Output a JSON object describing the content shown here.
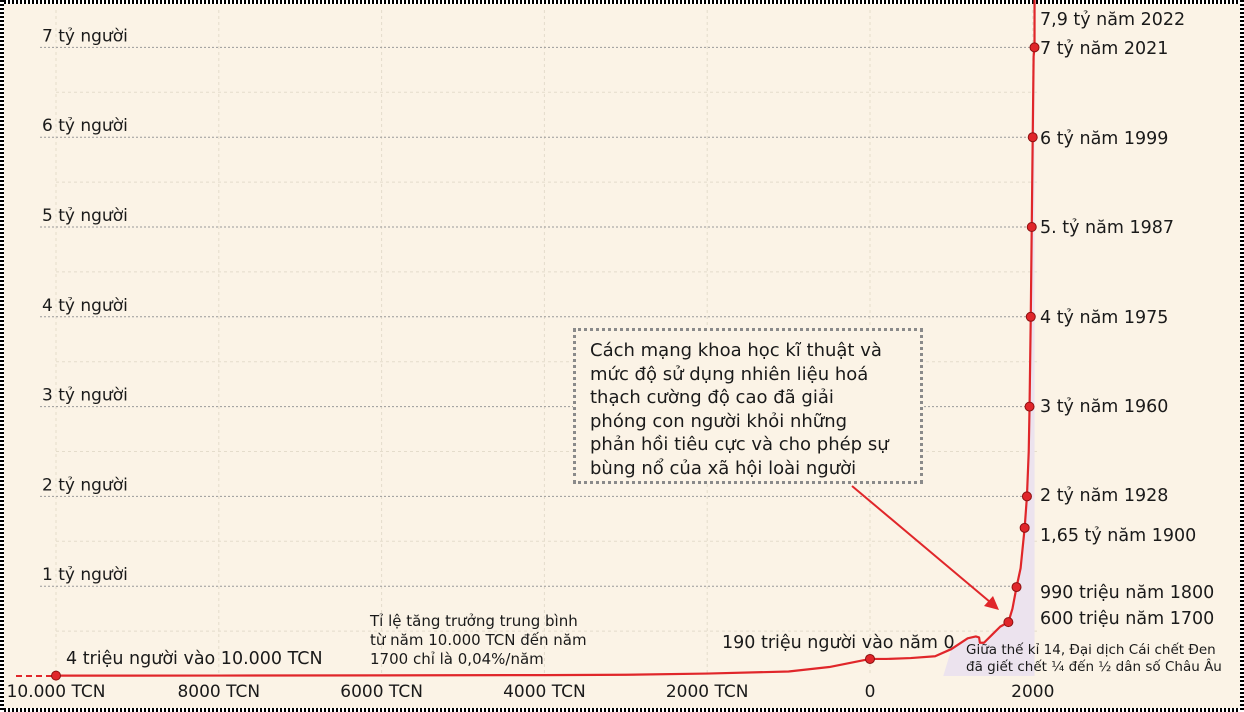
{
  "chart_data": {
    "type": "line",
    "x_ticks": [
      {
        "value": -10000,
        "label": "10.000 TCN"
      },
      {
        "value": -8000,
        "label": "8000 TCN"
      },
      {
        "value": -6000,
        "label": "6000 TCN"
      },
      {
        "value": -4000,
        "label": "4000 TCN"
      },
      {
        "value": -2000,
        "label": "2000 TCN"
      },
      {
        "value": 0,
        "label": "0"
      },
      {
        "value": 2000,
        "label": "2000"
      }
    ],
    "y_ticks": [
      {
        "value": 1,
        "label": "1 tỷ người"
      },
      {
        "value": 2,
        "label": "2 tỷ người"
      },
      {
        "value": 3,
        "label": "3 tỷ người"
      },
      {
        "value": 4,
        "label": "4 tỷ người"
      },
      {
        "value": 5,
        "label": "5 tỷ người"
      },
      {
        "value": 6,
        "label": "6 tỷ người"
      },
      {
        "value": 7,
        "label": "7 tỷ người"
      }
    ],
    "xlim": [
      -10700,
      2200
    ],
    "ylim": [
      0,
      7.3
    ],
    "grid": true,
    "line_color": "#e0262a",
    "series": [
      {
        "x": [
          -10000,
          -8000,
          -6000,
          -4000,
          -3000,
          -2000,
          -1000,
          -500,
          0,
          200,
          500,
          800,
          1000,
          1100,
          1200,
          1300,
          1340,
          1350,
          1400,
          1500,
          1600,
          1700,
          1750,
          1800,
          1850,
          1900,
          1928,
          1950,
          1960,
          1975,
          1987,
          1999,
          2010,
          2021,
          2022
        ],
        "y": [
          0.004,
          0.005,
          0.007,
          0.01,
          0.014,
          0.027,
          0.05,
          0.1,
          0.19,
          0.19,
          0.2,
          0.22,
          0.3,
          0.36,
          0.42,
          0.44,
          0.43,
          0.37,
          0.37,
          0.46,
          0.55,
          0.6,
          0.75,
          0.99,
          1.2,
          1.65,
          2.0,
          2.5,
          3.0,
          4.0,
          5.0,
          6.0,
          6.9,
          7.0,
          7.9
        ]
      }
    ],
    "points": [
      {
        "x": -10000,
        "y": 0.004,
        "label": "4 triệu người vào 10.000 TCN"
      },
      {
        "x": 0,
        "y": 0.19,
        "label": "190 triệu người vào năm 0"
      },
      {
        "x": 1700,
        "y": 0.6,
        "label": "600 triệu năm 1700"
      },
      {
        "x": 1800,
        "y": 0.99,
        "label": "990 triệu năm 1800"
      },
      {
        "x": 1900,
        "y": 1.65,
        "label": "1,65 tỷ năm 1900"
      },
      {
        "x": 1928,
        "y": 2,
        "label": "2 tỷ năm 1928"
      },
      {
        "x": 1960,
        "y": 3,
        "label": "3 tỷ năm 1960"
      },
      {
        "x": 1975,
        "y": 4,
        "label": "4 tỷ năm 1975"
      },
      {
        "x": 1987,
        "y": 5,
        "label": "5. tỷ năm 1987"
      },
      {
        "x": 1999,
        "y": 6,
        "label": "6 tỷ năm 1999"
      },
      {
        "x": 2021,
        "y": 7,
        "label": "7 tỷ năm 2021"
      },
      {
        "x": 2022,
        "y": 7.9,
        "label": "7,9 tỷ năm 2022"
      }
    ],
    "annotations": {
      "growth_note": [
        "Tỉ lệ tăng trưởng trung bình",
        "từ năm 10.000 TCN đến năm",
        "1700 chỉ là 0,04%/năm"
      ],
      "plague_note": [
        "Giữa thế kỉ 14, Đại dịch Cái chết Đen",
        "đã giết chết ¼ đến ½ dân số Châu Âu"
      ],
      "callout": [
        "Cách mạng khoa học kĩ thuật và",
        "mức độ sử dụng nhiên liệu hoá",
        "thạch cường độ cao đã giải",
        "phóng con người khỏi những",
        "phản hồi tiêu cực và cho phép sự",
        "bùng nổ của xã hội loài người"
      ]
    }
  }
}
